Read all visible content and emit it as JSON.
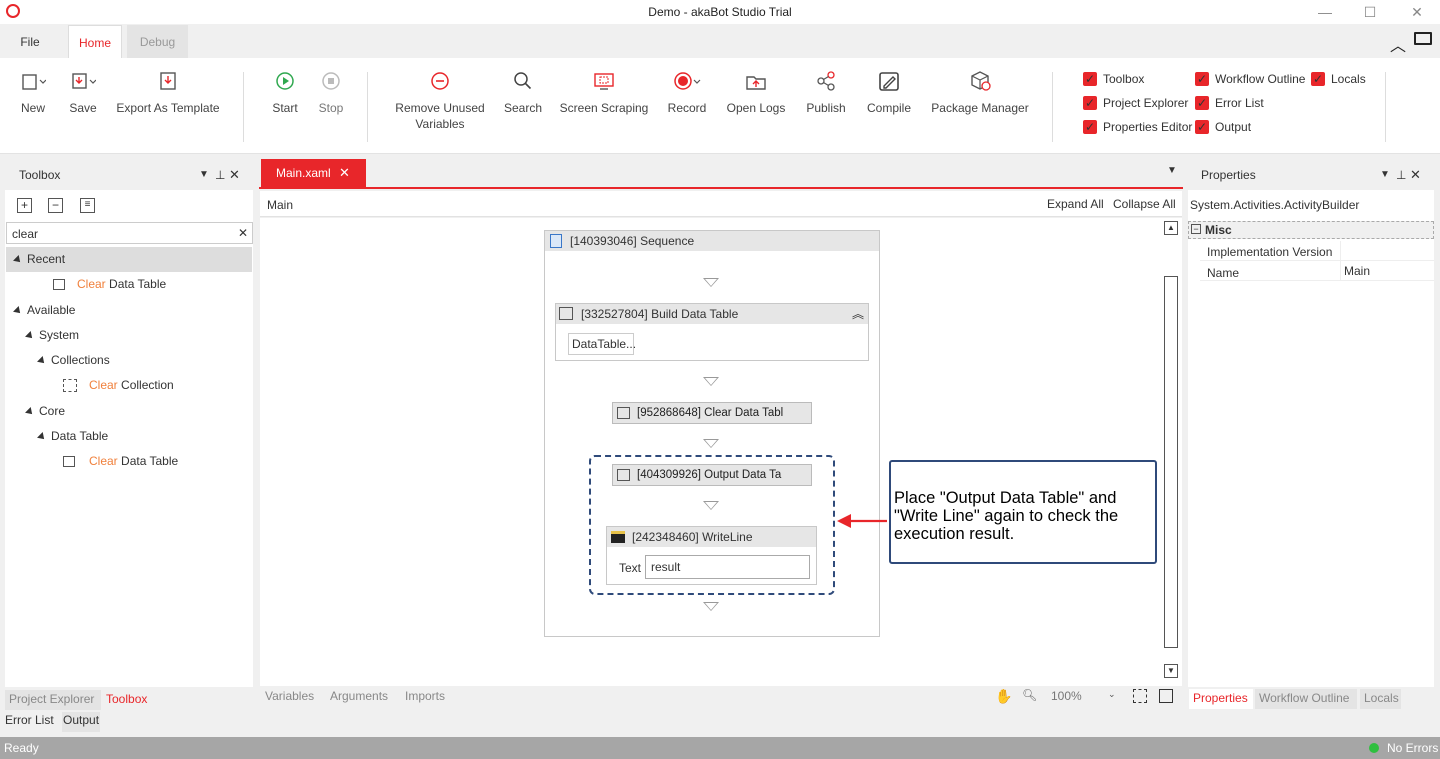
{
  "window": {
    "title": "Demo - akaBot Studio Trial"
  },
  "ribbon_tabs": [
    {
      "label": "File"
    },
    {
      "label": "Home"
    },
    {
      "label": "Debug"
    }
  ],
  "ribbon": {
    "new": "New",
    "save": "Save",
    "export": "Export As Template",
    "start": "Start",
    "stop": "Stop",
    "remove_unused": "Remove Unused Variables",
    "search": "Search",
    "screen_scraping": "Screen Scraping",
    "record": "Record",
    "open_logs": "Open Logs",
    "publish": "Publish",
    "compile": "Compile",
    "package_manager": "Package Manager"
  },
  "panels_checks": [
    {
      "label": "Toolbox"
    },
    {
      "label": "Project Explorer"
    },
    {
      "label": "Properties Editor"
    },
    {
      "label": "Workflow Outline"
    },
    {
      "label": "Error List"
    },
    {
      "label": "Output"
    },
    {
      "label": "Locals"
    }
  ],
  "toolbox": {
    "title": "Toolbox",
    "search_value": "clear",
    "recent": "Recent",
    "available": "Available",
    "system": "System",
    "collections": "Collections",
    "core": "Core",
    "data_table": "Data Table",
    "hl": "Clear",
    "item_data_table": "Data Table",
    "item_collection": "Collection"
  },
  "editor": {
    "tab": "Main.xaml",
    "breadcrumb": "Main",
    "expand_all": "Expand All",
    "collapse_all": "Collapse All",
    "sequence": "[140393046] Sequence",
    "build": "[332527804] Build Data Table",
    "build_btn": "DataTable...",
    "clear": "[952868648] Clear Data Tabl",
    "output": "[404309926] Output Data Ta",
    "writeline": "[242348460] WriteLine",
    "text_label": "Text",
    "text_value": "result",
    "callout": "Place \"Output Data Table\" and \"Write Line\" again to check the execution result.",
    "bottom_tabs": [
      {
        "label": "Variables"
      },
      {
        "label": "Arguments"
      },
      {
        "label": "Imports"
      }
    ],
    "zoom": "100%"
  },
  "properties": {
    "title": "Properties",
    "type": "System.Activities.ActivityBuilder",
    "category": "Misc",
    "rows": [
      {
        "name": "Implementation Version",
        "value": ""
      },
      {
        "name": "Name",
        "value": "Main"
      }
    ]
  },
  "left_bottom_tabs": [
    {
      "label": "Project Explorer"
    },
    {
      "label": "Toolbox"
    }
  ],
  "right_bottom_tabs": [
    {
      "label": "Properties"
    },
    {
      "label": "Workflow Outline"
    },
    {
      "label": "Locals"
    }
  ],
  "output_tabs": [
    {
      "label": "Error List"
    },
    {
      "label": "Output"
    }
  ],
  "status": {
    "left": "Ready",
    "right": "No Errors"
  },
  "colors": {
    "accent": "#e8262a",
    "status_bar": "#a6a6a6",
    "callout_border": "#2f4a7a",
    "ok": "#2fbf3f"
  }
}
